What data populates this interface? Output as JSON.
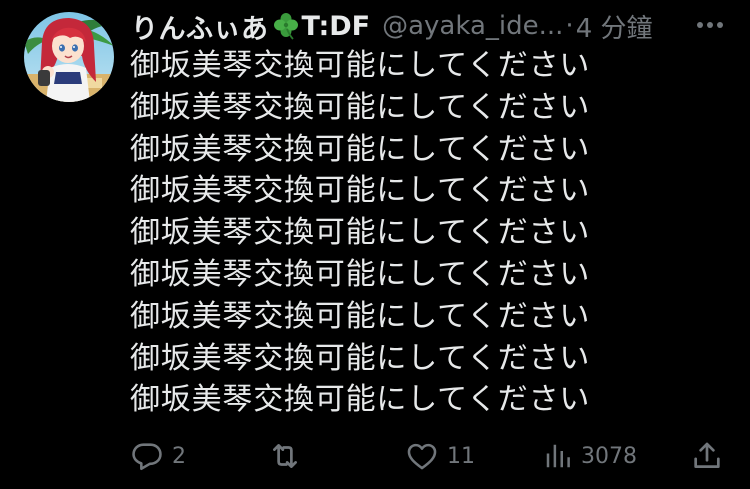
{
  "author": {
    "display_name": "りんふぃあ",
    "badge_emoji_icon": "four-leaf-clover-icon",
    "badge_text": "T:DF",
    "handle": "@ayaka_ide...",
    "separator": "·",
    "timestamp": "4 分鐘"
  },
  "tweet": {
    "lines": [
      "御坂美琴交換可能にしてください",
      "御坂美琴交換可能にしてください",
      "御坂美琴交換可能にしてください",
      "御坂美琴交換可能にしてください",
      "御坂美琴交換可能にしてください",
      "御坂美琴交換可能にしてください",
      "御坂美琴交換可能にしてください",
      "御坂美琴交換可能にしてください",
      "御坂美琴交換可能にしてください"
    ]
  },
  "actions": {
    "reply_count": "2",
    "retweet_count": "",
    "like_count": "11",
    "views_count": "3078"
  },
  "colors": {
    "background": "#000000",
    "primary_text": "#e7e9ea",
    "secondary_text": "#71767b",
    "clover_green": "#3a9a3c"
  }
}
